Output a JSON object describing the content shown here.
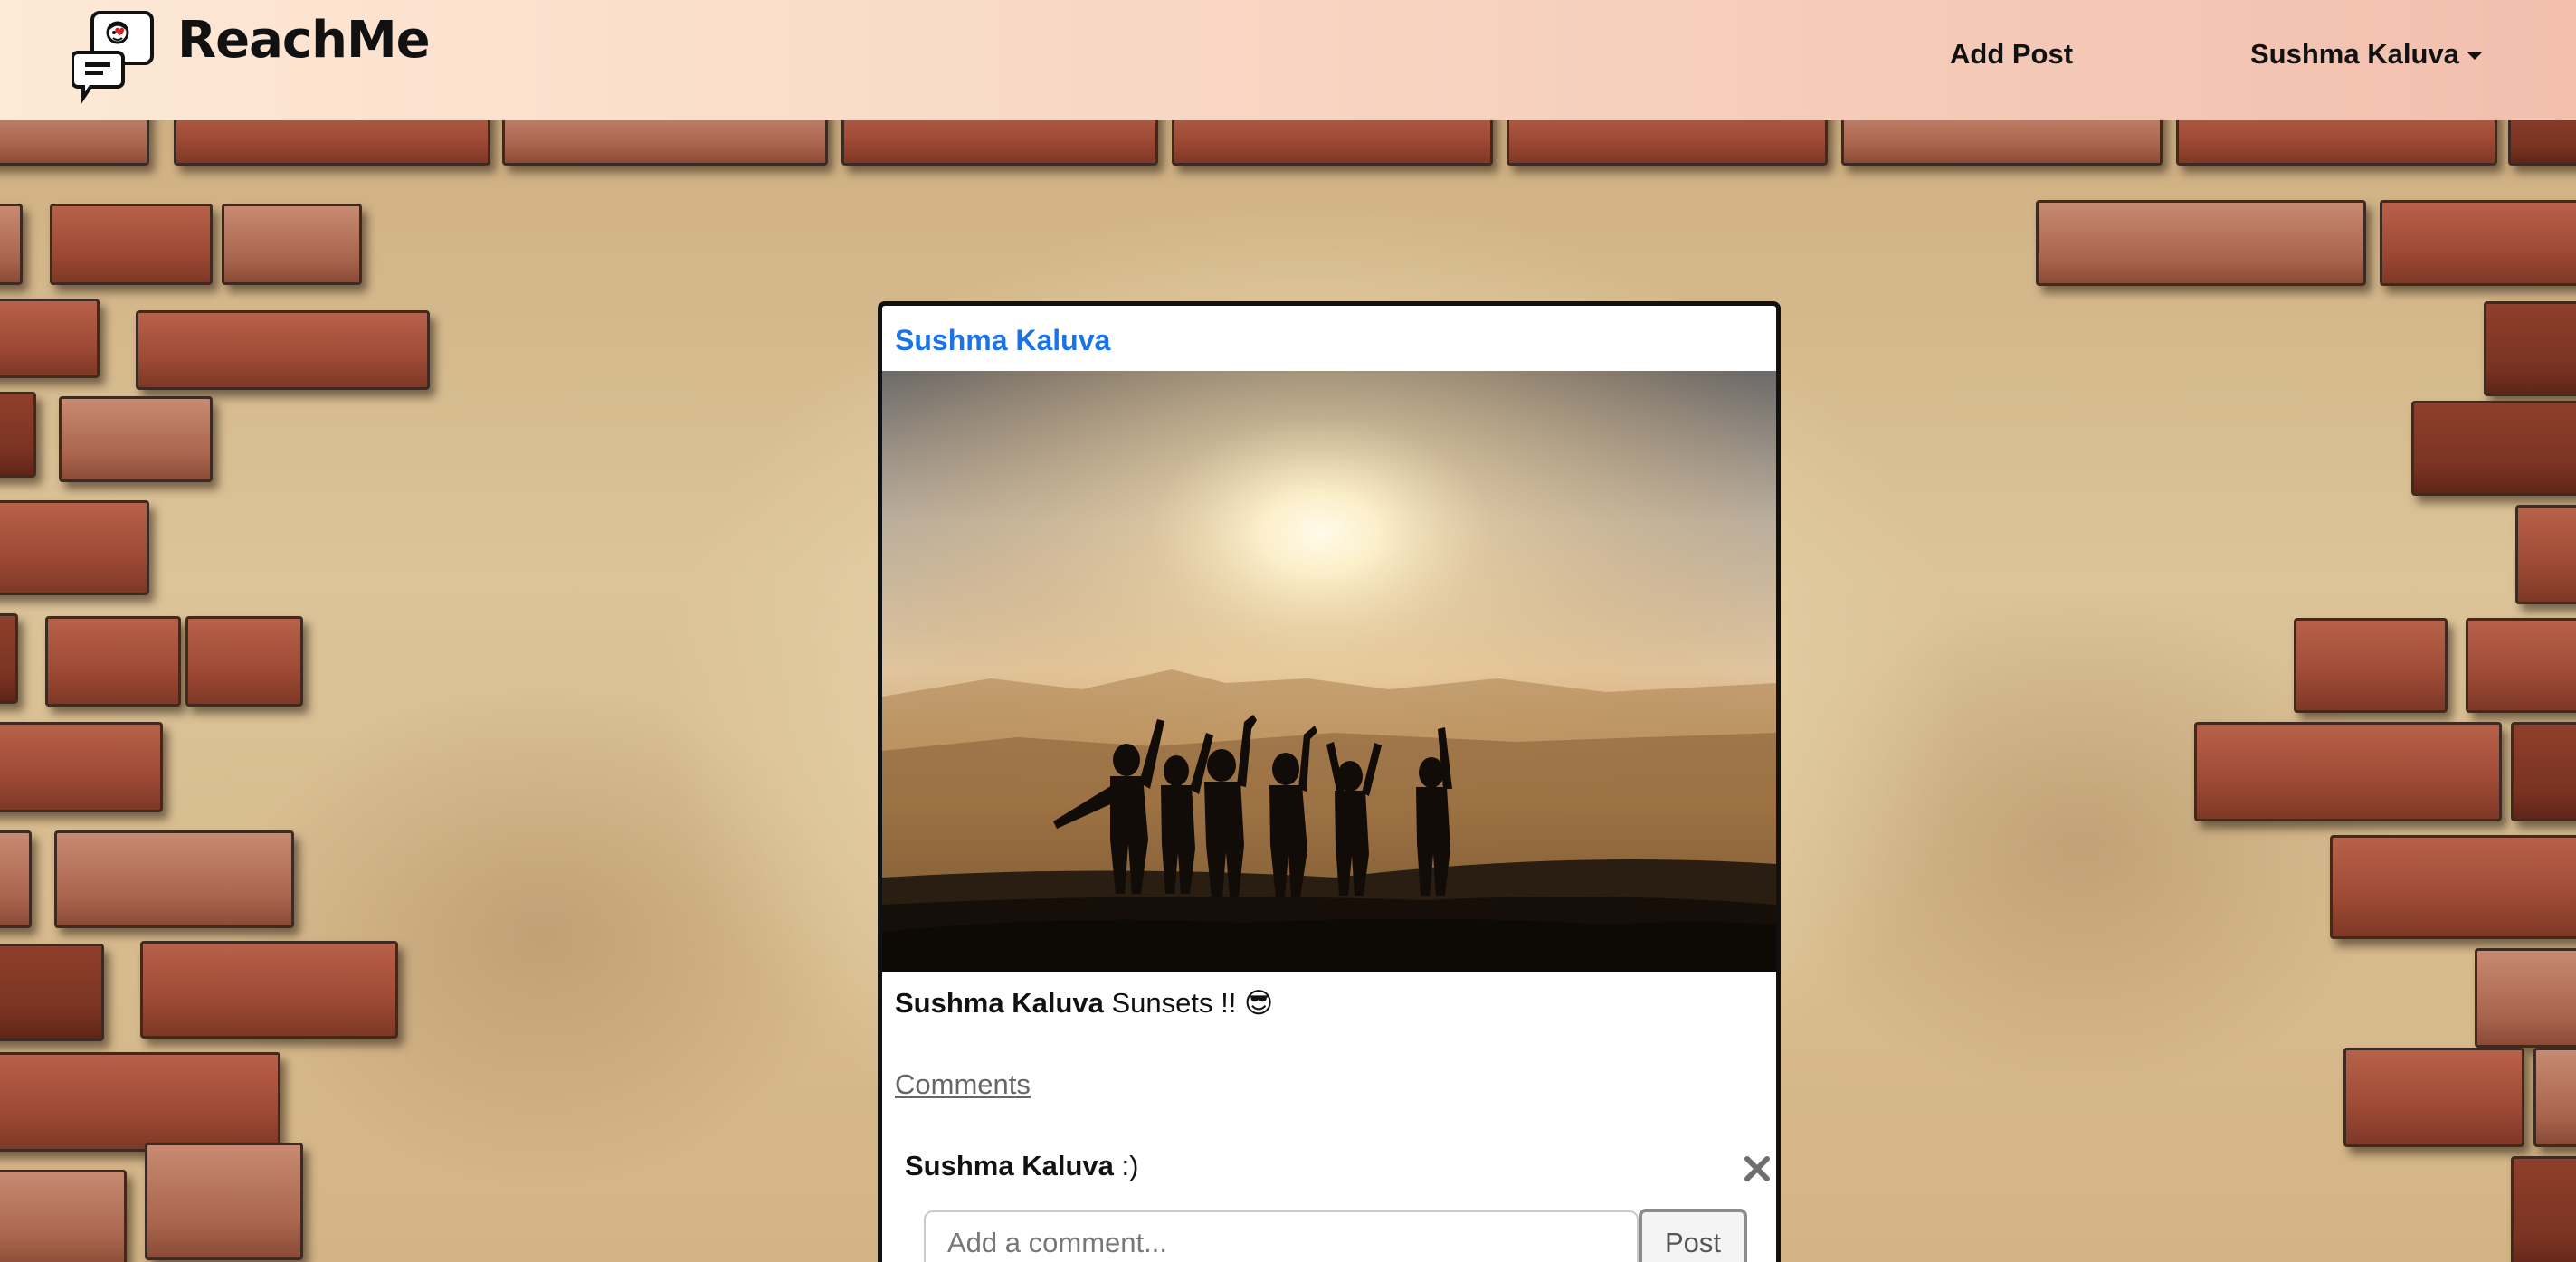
{
  "navbar": {
    "brand": "ReachMe",
    "add_post": "Add Post",
    "user_menu": "Sushma Kaluva"
  },
  "post": {
    "author": "Sushma Kaluva",
    "photo_icon": "sunset-group-photo",
    "caption_author": "Sushma Kaluva",
    "caption_text": " Sunsets !! ",
    "caption_emoji": "😎",
    "comments_link": "Comments",
    "comments": [
      {
        "author": "Sushma Kaluva",
        "text": " :)"
      }
    ],
    "add_comment_placeholder": "Add a comment...",
    "post_button": "Post"
  },
  "colors": {
    "author_link": "#1a73e8",
    "navbar_gradient_start": "#fde9d6",
    "navbar_gradient_end": "#f2bfad"
  }
}
